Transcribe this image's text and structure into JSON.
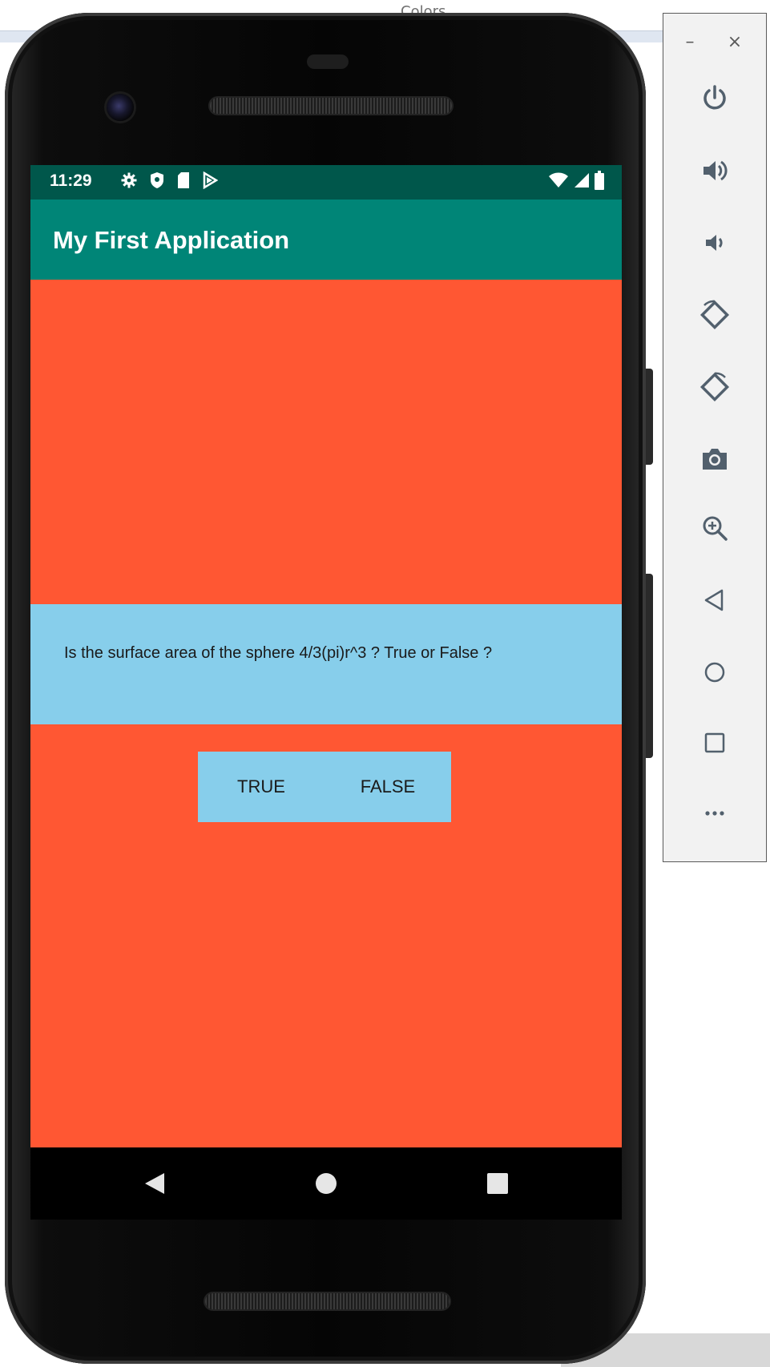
{
  "background_window": {
    "title_fragment": "Colors"
  },
  "device": {
    "status_bar": {
      "time": "11:29",
      "left_icons": [
        "gear-icon",
        "shield-icon",
        "sd-card-icon",
        "play-icon"
      ],
      "right_icons": [
        "wifi-icon",
        "signal-icon",
        "battery-icon"
      ]
    },
    "app_bar": {
      "title": "My First Application"
    },
    "question": {
      "text": "Is the surface area of the sphere 4/3(pi)r^3 ? True or False ?"
    },
    "buttons": {
      "true_label": "TRUE",
      "false_label": "FALSE"
    },
    "nav_bar": {
      "items": [
        "back-icon",
        "home-icon",
        "recents-icon"
      ]
    },
    "colors": {
      "screen_background": "#FF5733",
      "panel_background": "#87CEEB",
      "app_bar": "#008577",
      "status_bar": "#00574B"
    }
  },
  "emulator_panel": {
    "window_controls": {
      "minimize": "–",
      "close": "×"
    },
    "tools": [
      "power-icon",
      "volume-up-icon",
      "volume-down-icon",
      "rotate-left-icon",
      "rotate-right-icon",
      "camera-icon",
      "zoom-icon",
      "back-triangle-icon",
      "home-circle-icon",
      "overview-square-icon",
      "more-icon"
    ]
  }
}
